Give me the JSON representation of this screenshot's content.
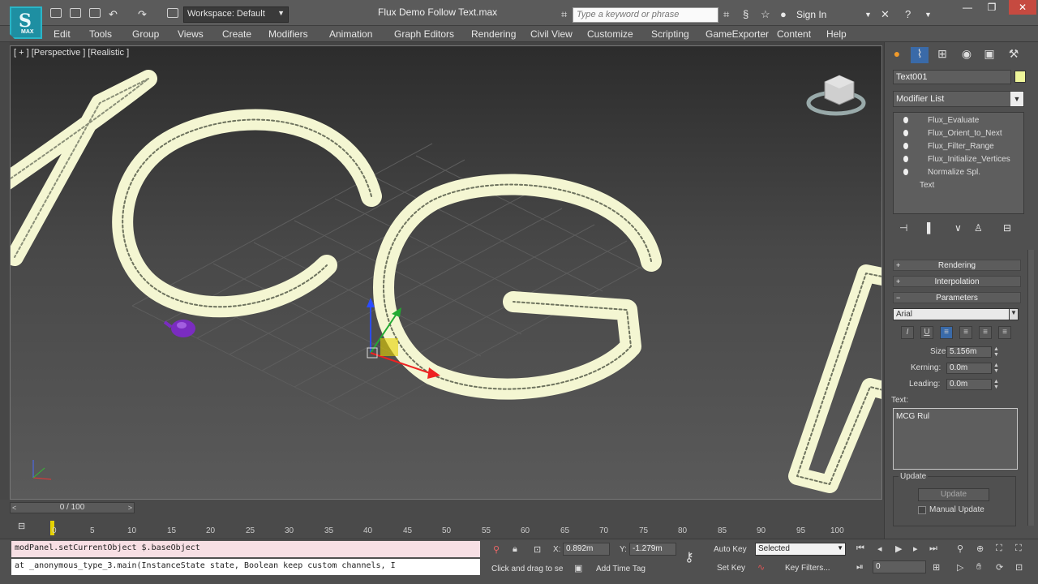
{
  "app": {
    "logo_text": "S",
    "logo_sub": "MAX",
    "window_title": "Flux Demo Follow Text.max",
    "workspace": "Workspace: Default",
    "search_placeholder": "Type a keyword or phrase",
    "sign_in": "Sign In"
  },
  "menu": [
    "Edit",
    "Tools",
    "Group",
    "Views",
    "Create",
    "Modifiers",
    "Animation",
    "Graph Editors",
    "Rendering",
    "Civil View",
    "Customize",
    "Scripting",
    "GameExporter",
    "Content",
    "Help"
  ],
  "viewport": {
    "label": "[ + ] [Perspective ] [Realistic ]"
  },
  "command_panel": {
    "object_name": "Text001",
    "object_color": "#eef59a",
    "modifier_list": "Modifier List",
    "stack": [
      "Flux_Evaluate",
      "Flux_Orient_to_Next",
      "Flux_Filter_Range",
      "Flux_Initialize_Vertices",
      "Normalize Spl."
    ],
    "stack_base": "Text",
    "rollouts": {
      "rendering": "Rendering",
      "interpolation": "Interpolation",
      "parameters": "Parameters"
    },
    "font": "Arial",
    "size_label": "Size:",
    "size_value": "5.156m",
    "kerning_label": "Kerning:",
    "kerning_value": "0.0m",
    "leading_label": "Leading:",
    "leading_value": "0.0m",
    "text_label": "Text:",
    "text_value": "MCG Rul",
    "update_group": "Update",
    "update_button": "Update",
    "manual_update": "Manual Update"
  },
  "timeline": {
    "slider": "0 / 100",
    "ticks": [
      "0",
      "5",
      "10",
      "15",
      "20",
      "25",
      "30",
      "35",
      "40",
      "45",
      "50",
      "55",
      "60",
      "65",
      "70",
      "75",
      "80",
      "85",
      "90",
      "95",
      "100"
    ]
  },
  "status": {
    "listener_input": "modPanel.setCurrentObject $.baseObject",
    "listener_output": "at _anonymous_type_3.main(InstanceState state, Boolean keep custom channels, I",
    "x_label": "X:",
    "x_value": "0.892m",
    "y_label": "Y:",
    "y_value": "-1.279m",
    "prompt": "Click and drag to se",
    "add_time_tag": "Add Time Tag",
    "auto_key": "Auto Key",
    "set_key": "Set Key",
    "selected": "Selected",
    "key_filters": "Key Filters...",
    "frame": "0"
  }
}
